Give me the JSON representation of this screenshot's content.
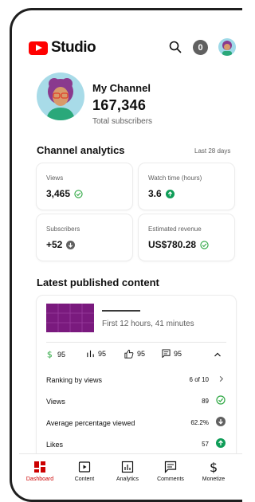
{
  "app": {
    "logo_text": "Studio",
    "notification_count": "0"
  },
  "channel": {
    "name": "My Channel",
    "subscriber_count": "167,346",
    "subscriber_label": "Total subscribers"
  },
  "analytics": {
    "title": "Channel analytics",
    "range": "Last 28 days",
    "cards": [
      {
        "label": "Views",
        "value": "3,465",
        "status_icon": "check-circle-icon"
      },
      {
        "label": "Watch time (hours)",
        "value": "3.6",
        "status_icon": "arrow-up-circle-icon"
      },
      {
        "label": "Subscribers",
        "value": "+52",
        "status_icon": "arrow-down-circle-icon"
      },
      {
        "label": "Estimated revenue",
        "value": "US$780.28",
        "status_icon": "check-circle-icon"
      }
    ]
  },
  "latest": {
    "title": "Latest published content",
    "duration": "First 12 hours, 41 minutes",
    "stats": [
      {
        "icon": "dollar-icon",
        "value": "95"
      },
      {
        "icon": "bar-chart-icon",
        "value": "95"
      },
      {
        "icon": "thumbs-up-icon",
        "value": "95"
      },
      {
        "icon": "comment-icon",
        "value": "95"
      }
    ],
    "rows": [
      {
        "label": "Ranking by views",
        "value": "6 of 10",
        "icon": "chevron-right-icon"
      },
      {
        "label": "Views",
        "value": "89",
        "icon": "check-circle-icon"
      },
      {
        "label": "Average percentage viewed",
        "value": "62.2%",
        "icon": "arrow-down-circle-icon"
      },
      {
        "label": "Likes",
        "value": "57",
        "icon": "arrow-up-circle-icon"
      }
    ]
  },
  "nav": [
    {
      "label": "Dashboard",
      "icon": "dashboard-icon",
      "active": true
    },
    {
      "label": "Content",
      "icon": "content-icon",
      "active": false
    },
    {
      "label": "Analytics",
      "icon": "analytics-icon",
      "active": false
    },
    {
      "label": "Comments",
      "icon": "comments-icon",
      "active": false
    },
    {
      "label": "Monetize",
      "icon": "monetize-icon",
      "active": false
    }
  ],
  "colors": {
    "brand_red": "#ff0000",
    "check_green": "#2ba640",
    "up_green": "#0f9d58",
    "down_gray": "#606060",
    "thumbnail": "#7a1a7e"
  }
}
